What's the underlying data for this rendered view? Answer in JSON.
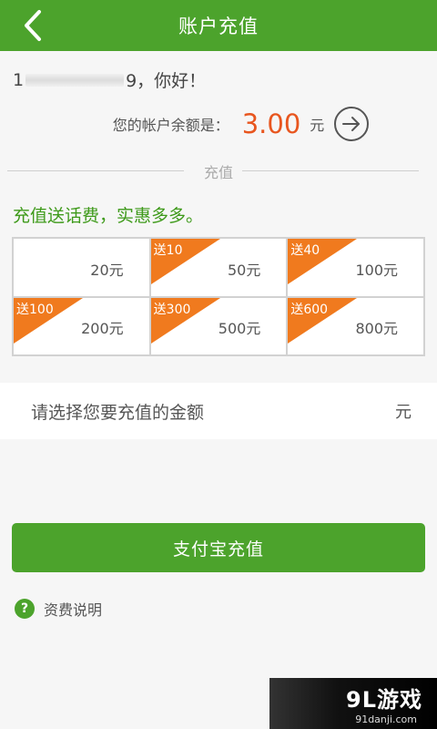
{
  "header": {
    "title": "账户充值",
    "back_icon": "chevron-left-icon"
  },
  "greeting": {
    "prefix": "1",
    "suffix": "9，你好！"
  },
  "balance": {
    "label": "您的帐户余额是：",
    "value": "3.00",
    "unit": "元",
    "arrow_icon": "arrow-right-circle-icon"
  },
  "section": {
    "divider_label": "充值"
  },
  "promo": {
    "text": "充值送话费，实惠多多。"
  },
  "options": [
    {
      "bonus": "",
      "amount": "20元"
    },
    {
      "bonus": "送10",
      "amount": "50元"
    },
    {
      "bonus": "送40",
      "amount": "100元"
    },
    {
      "bonus": "送100",
      "amount": "200元"
    },
    {
      "bonus": "送300",
      "amount": "500元"
    },
    {
      "bonus": "送600",
      "amount": "800元"
    }
  ],
  "amount_input": {
    "placeholder": "请选择您要充值的金额",
    "unit": "元"
  },
  "pay_button": {
    "label": "支付宝充值"
  },
  "fee_info": {
    "icon": "help-icon",
    "label": "资费说明"
  },
  "watermark": {
    "main": "9L游戏",
    "sub": "91danji.com"
  },
  "colors": {
    "primary_green": "#4ca32c",
    "accent_orange": "#f07a1e",
    "balance_red": "#e8561f",
    "promo_green": "#3e9a1a"
  }
}
